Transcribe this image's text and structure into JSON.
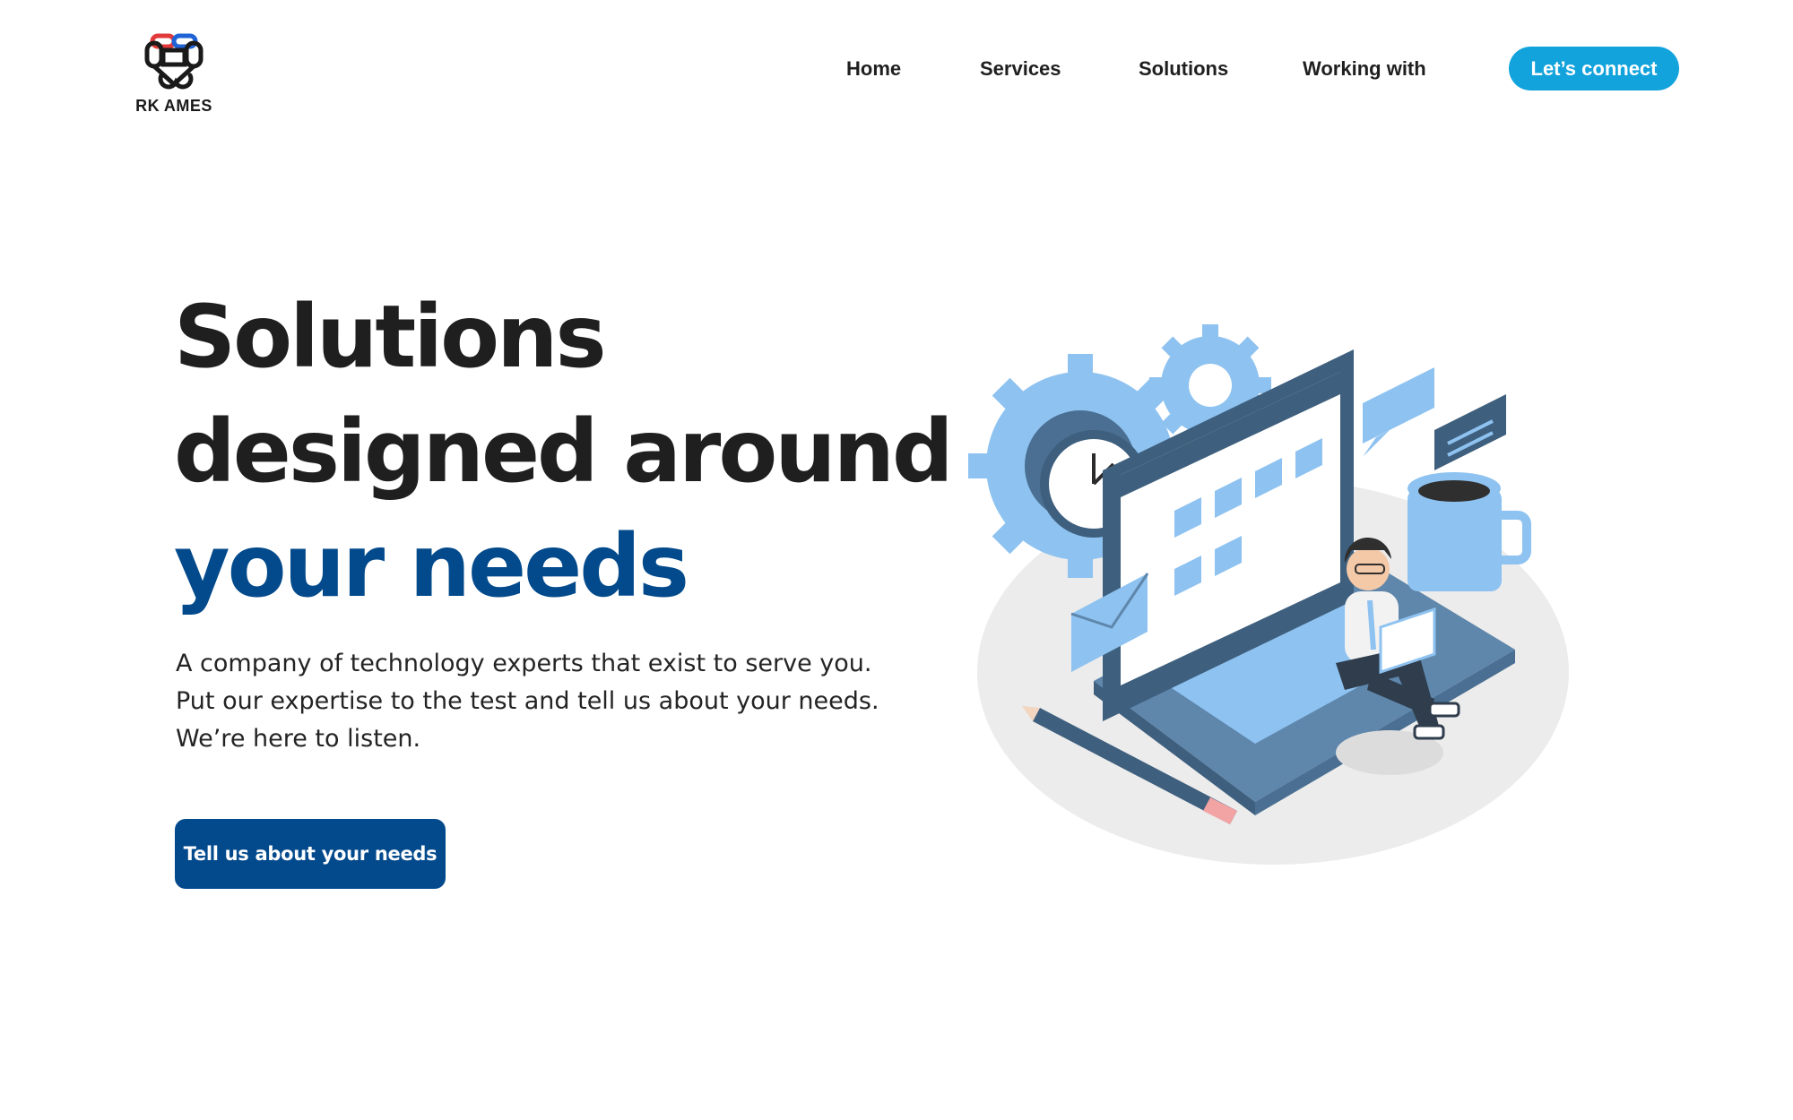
{
  "brand": {
    "name": "RK AMES"
  },
  "nav": {
    "items": [
      {
        "label": "Home"
      },
      {
        "label": "Services"
      },
      {
        "label": "Solutions"
      },
      {
        "label": "Working with"
      }
    ],
    "cta_label": "Let’s connect"
  },
  "hero": {
    "title_line1": "Solutions",
    "title_line2": "designed around",
    "title_line3": "your needs",
    "subtitle": [
      "A company of technology experts that exist to serve you.",
      "Put our expertise to the test and tell us about your needs.",
      "We’re here to listen."
    ],
    "cta_label": "Tell us about your needs"
  },
  "colors": {
    "accent": "#12a2dc",
    "brand_blue": "#034a8d",
    "illustration_blue": "#8ec2f0",
    "illustration_dark": "#3e5f7d"
  },
  "icons": [
    "logo-knot-icon",
    "gear-icon",
    "clock-icon",
    "laptop-icon",
    "chat-bubble-icon",
    "mug-icon",
    "envelope-icon",
    "pencil-icon"
  ]
}
